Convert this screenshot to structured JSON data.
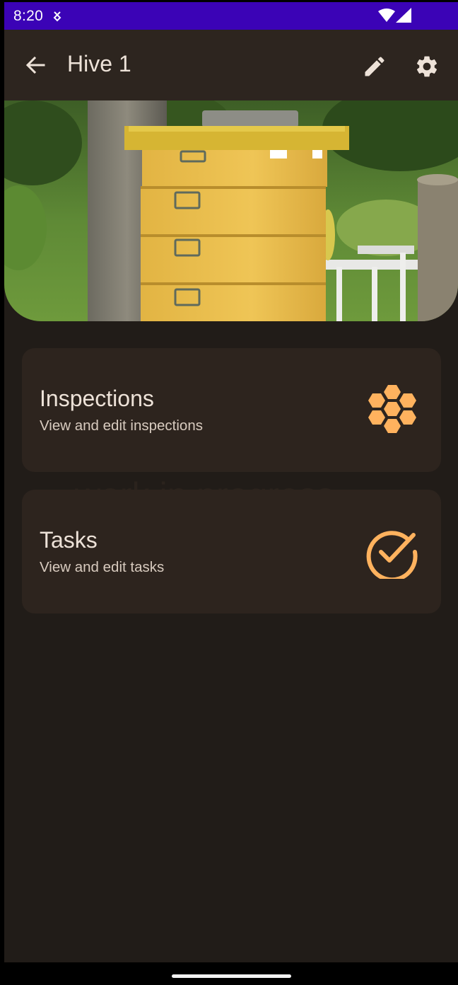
{
  "status_bar": {
    "time": "8:20",
    "notification_icon": "usb-debug-icon",
    "wifi_icon": "wifi-icon",
    "signal_icon": "cell-signal-icon"
  },
  "app_bar": {
    "title": "Hive 1",
    "back_icon": "arrow-back-icon",
    "edit_icon": "pencil-icon",
    "settings_icon": "gear-icon"
  },
  "hero_image": {
    "subject": "yellow-beehive-photo"
  },
  "background_text": "work in progress",
  "cards": [
    {
      "title": "Inspections",
      "subtitle": "View and edit inspections",
      "icon": "honeycomb-icon"
    },
    {
      "title": "Tasks",
      "subtitle": "View and edit tasks",
      "icon": "check-circle-icon"
    }
  ],
  "colors": {
    "status_bar": "#3b03b6",
    "app_bar": "#2d251f",
    "background": "#211c18",
    "card": "#2d241e",
    "accent": "#ffb25e",
    "text_primary": "#ede2d8"
  }
}
